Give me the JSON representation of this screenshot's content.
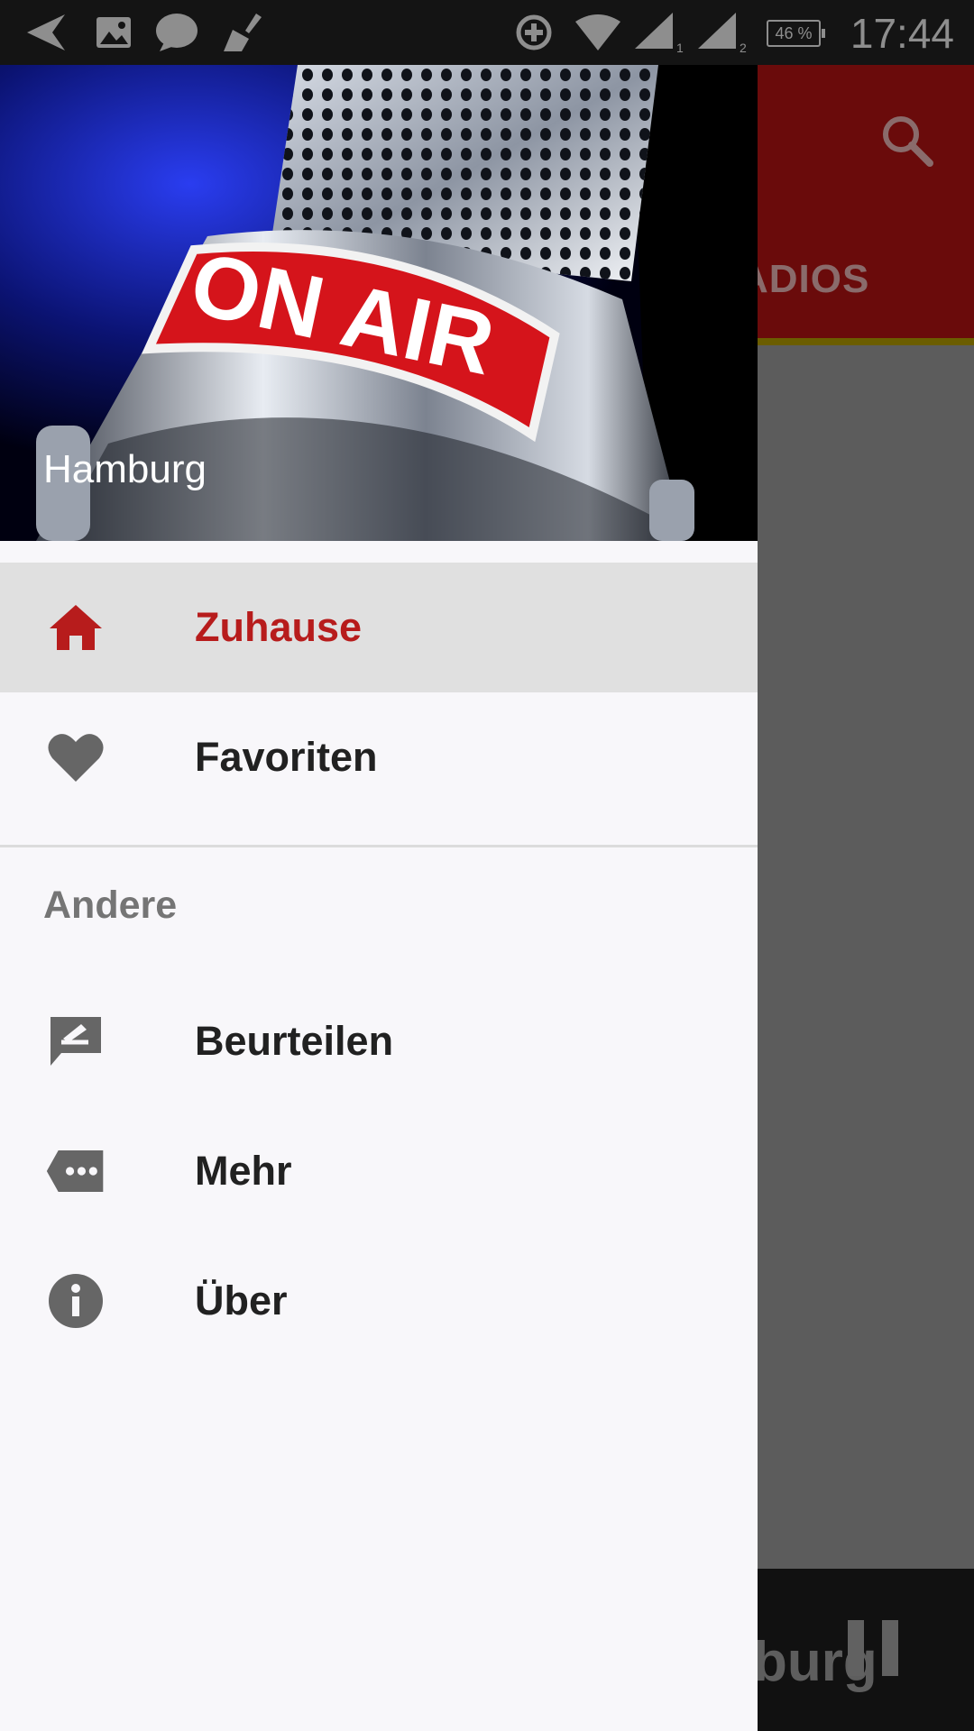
{
  "status_bar": {
    "time": "17:44",
    "battery": "46 %",
    "icons": [
      "back-arrow-icon",
      "image-icon",
      "chat-bubble-icon",
      "broom-icon",
      "data-saver-icon",
      "wifi-icon",
      "signal-1-icon",
      "signal-2-icon"
    ],
    "sim_labels": [
      "1",
      "2"
    ]
  },
  "background_app": {
    "tab_label": "ADIOS",
    "player_text": "burg"
  },
  "drawer": {
    "header_title": "Hamburg",
    "header_image_text": "ON AIR",
    "primary_items": [
      {
        "label": "Zuhause",
        "icon": "home-icon",
        "selected": true
      },
      {
        "label": "Favoriten",
        "icon": "heart-icon",
        "selected": false
      }
    ],
    "section_title": "Andere",
    "secondary_items": [
      {
        "label": "Beurteilen",
        "icon": "rate-review-icon"
      },
      {
        "label": "Mehr",
        "icon": "more-tag-icon"
      },
      {
        "label": "Über",
        "icon": "info-icon"
      }
    ]
  },
  "colors": {
    "accent": "#b71c1c",
    "toolbar": "#6a0b0b",
    "selected_bg": "#e0e0e0",
    "drawer_bg": "#f8f7fa"
  }
}
